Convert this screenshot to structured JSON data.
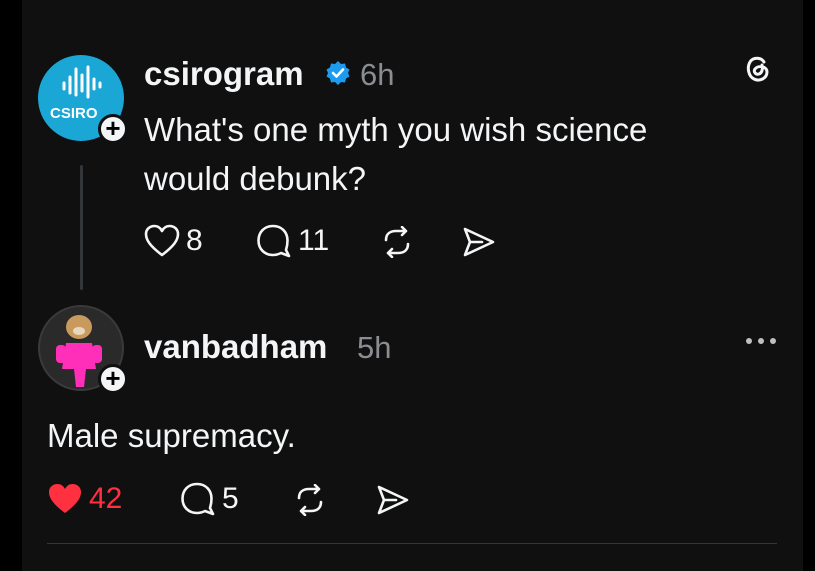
{
  "post": {
    "username": "csirogram",
    "time": "6h",
    "text_line1": "What's one myth you wish science",
    "text_line2": "would debunk?",
    "avatar_text": "CSIRO",
    "likes": "8",
    "replies": "11"
  },
  "reply": {
    "username": "vanbadham",
    "time": "5h",
    "text": "Male supremacy.",
    "likes": "42",
    "replies": "5"
  },
  "icons": {
    "verified": "verified-badge-icon",
    "threads": "threads-logo-icon",
    "more": "more-options-icon",
    "like": "heart-icon",
    "reply": "comment-icon",
    "repost": "repost-icon",
    "share": "share-icon",
    "follow": "plus-icon"
  },
  "colors": {
    "background": "#101010",
    "text": "#f3f5f7",
    "muted": "#8a8d91",
    "verified": "#1d9bf0",
    "liked": "#ff3040",
    "csiro_blue": "#1ba7d6"
  }
}
